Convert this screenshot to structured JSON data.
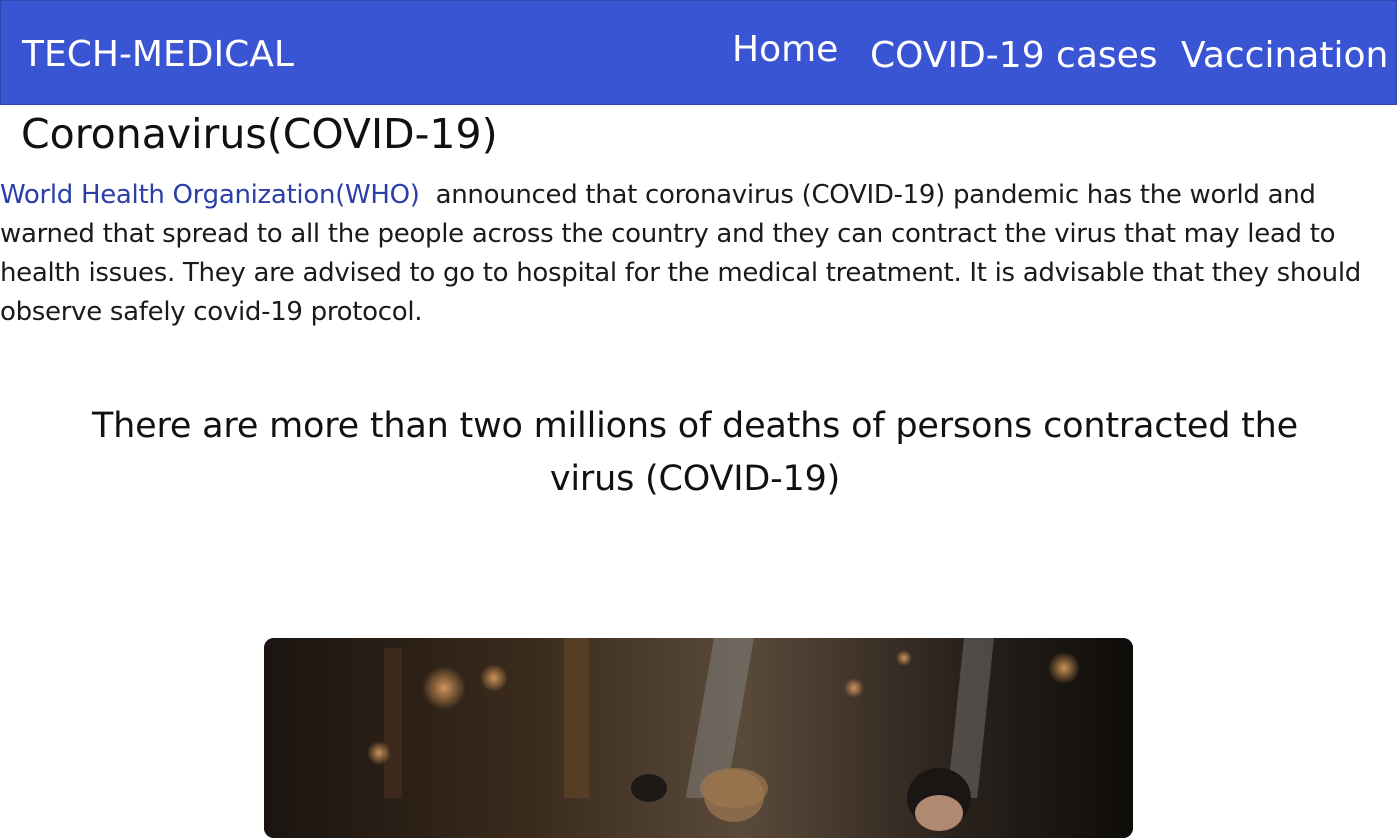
{
  "navbar": {
    "brand": "TECH-MEDICAL",
    "links": [
      {
        "label": "Home"
      },
      {
        "label": "COVID-19 cases"
      },
      {
        "label": "Vaccination"
      }
    ],
    "background_color": "#3a55d4"
  },
  "main": {
    "title": "Coronavirus(COVID-19)",
    "intro": {
      "link_text": "World Health Organization(WHO)",
      "body": "announced that coronavirus (COVID-19) pandemic has the world and warned that spread to all the people across the country and they can contract the virus that may lead to health issues. They are advised to go to hospital for the medical treatment. It is advisable that they should observe safely covid-19 protocol."
    },
    "statistic": "There are more than two millions of deaths of persons contracted the virus (COVID-19)",
    "image": {
      "icon": "photo-people-wearing-masks"
    }
  }
}
